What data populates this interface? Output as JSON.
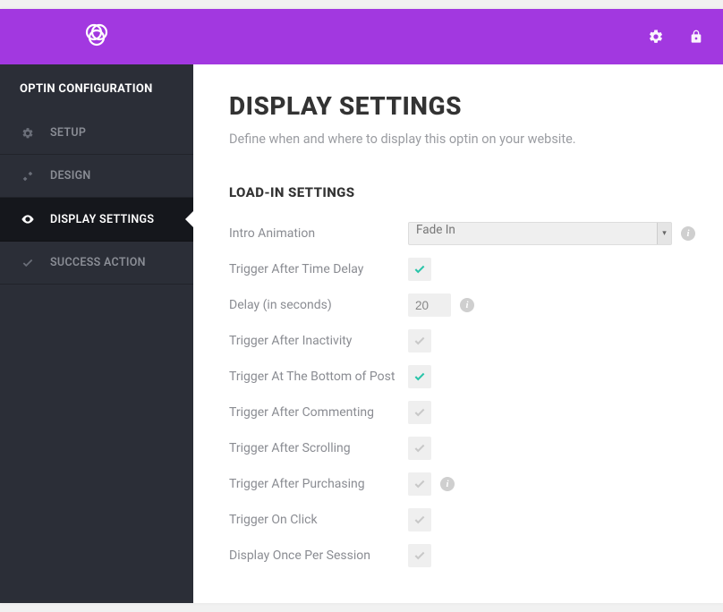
{
  "sidebar": {
    "title": "OPTIN CONFIGURATION",
    "items": [
      {
        "label": "SETUP"
      },
      {
        "label": "DESIGN"
      },
      {
        "label": "DISPLAY SETTINGS"
      },
      {
        "label": "SUCCESS ACTION"
      }
    ]
  },
  "page": {
    "title": "DISPLAY SETTINGS",
    "subtitle": "Define when and where to display this optin on your website."
  },
  "section": {
    "title": "LOAD-IN SETTINGS"
  },
  "settings": {
    "intro_animation": {
      "label": "Intro Animation",
      "value": "Fade In"
    },
    "trigger_time_delay": {
      "label": "Trigger After Time Delay"
    },
    "delay_seconds": {
      "label": "Delay (in seconds)",
      "value": "20"
    },
    "trigger_inactivity": {
      "label": "Trigger After Inactivity"
    },
    "trigger_bottom_post": {
      "label": "Trigger At The Bottom of Post"
    },
    "trigger_commenting": {
      "label": "Trigger After Commenting"
    },
    "trigger_scrolling": {
      "label": "Trigger After Scrolling"
    },
    "trigger_purchasing": {
      "label": "Trigger After Purchasing"
    },
    "trigger_click": {
      "label": "Trigger On Click"
    },
    "display_once": {
      "label": "Display Once Per Session"
    }
  }
}
